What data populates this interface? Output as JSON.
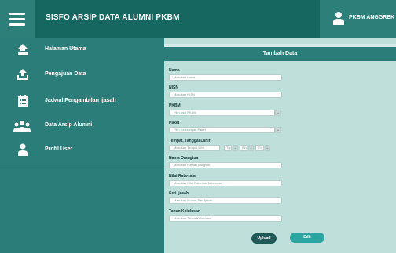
{
  "header": {
    "title": "SISFO ARSIP DATA ALUMNI PKBM",
    "user_name": "PKBM ANGGREK"
  },
  "sidebar": {
    "items": [
      {
        "label": "Halaman Utama",
        "icon": "home-upload-icon"
      },
      {
        "label": "Pengajuan Data",
        "icon": "upload-icon"
      },
      {
        "label": "Jadwal Pengambilan Ijasah",
        "icon": "calendar-icon"
      },
      {
        "label": "Data Arsip Alumni",
        "icon": "group-icon"
      },
      {
        "label": "Profil User",
        "icon": "user-icon"
      }
    ]
  },
  "form": {
    "title": "Tambah Data",
    "nama": {
      "label": "Nama",
      "placeholder": "Masukan nama"
    },
    "nisn": {
      "label": "NISN",
      "placeholder": "Masukan NISN"
    },
    "pkbm": {
      "label": "PKBM",
      "value": "Pilih Asal PKBM"
    },
    "paket": {
      "label": "Paket",
      "value": "Pilih Keterangan Paket"
    },
    "ttl": {
      "label": "Tempat, Tanggal Lahir",
      "tempat_placeholder": "Masukan Tempat lahir",
      "tgl": "Tgl",
      "bln": "Bln",
      "thn": "Th"
    },
    "orangtua": {
      "label": "Nama Orangtua",
      "placeholder": "Masukan Nama Orangtua"
    },
    "nilai": {
      "label": "Nilai Rata-rata",
      "placeholder": "Masukan Nilai Rata-rata kelulusan"
    },
    "seri_ijasah": {
      "label": "Seri Ijasah",
      "placeholder": "Masukan Nomor Seri Ijasah"
    },
    "tahun_kelulusan": {
      "label": "Tahun Kelulusan",
      "placeholder": "Masukan Tahun Kelulusan"
    },
    "upload_label": "Upload",
    "edit_label": "Edit"
  },
  "colors": {
    "header": "#16675f",
    "sidebar": "#2a7d78",
    "main_bg": "#bfdfdb",
    "accent_button": "#2aa5a0"
  }
}
